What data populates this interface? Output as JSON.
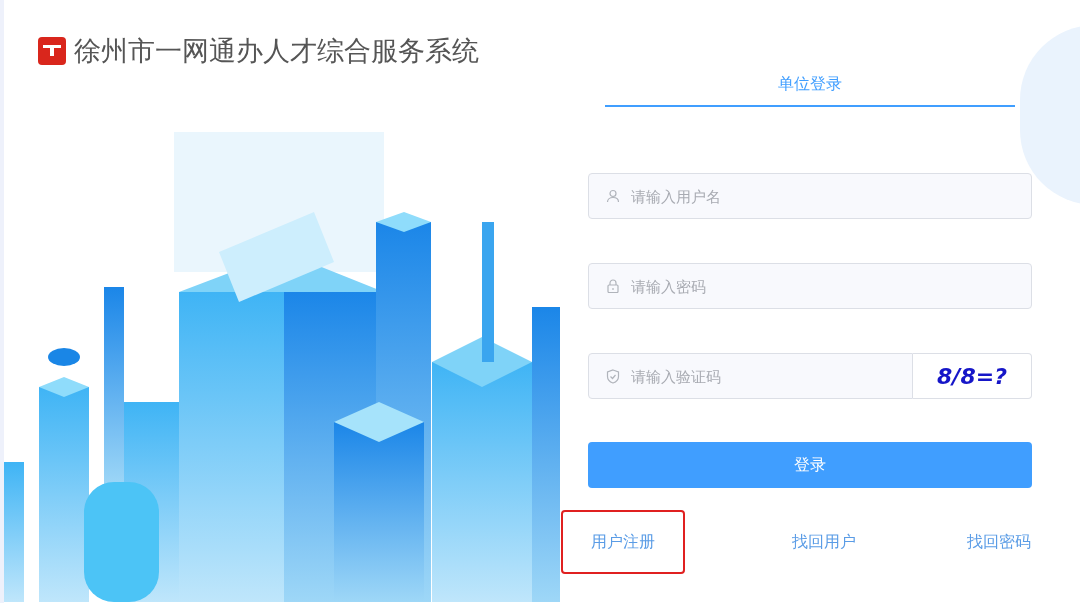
{
  "header": {
    "title": "徐州市一网通办人才综合服务系统"
  },
  "tabs": [
    {
      "label": "单位登录",
      "selected": true
    }
  ],
  "fields": [
    {
      "kind": "user",
      "placeholder": "请输入用户名"
    },
    {
      "kind": "lock",
      "placeholder": "请输入密码"
    },
    {
      "kind": "shield",
      "placeholder": "请输入验证码",
      "captcha": "8/8=?"
    }
  ],
  "login_button": "登录",
  "links": [
    {
      "label": "用户注册",
      "highlighted": true
    },
    {
      "label": "找回用户",
      "highlighted": false
    },
    {
      "label": "找回密码",
      "highlighted": false
    }
  ]
}
